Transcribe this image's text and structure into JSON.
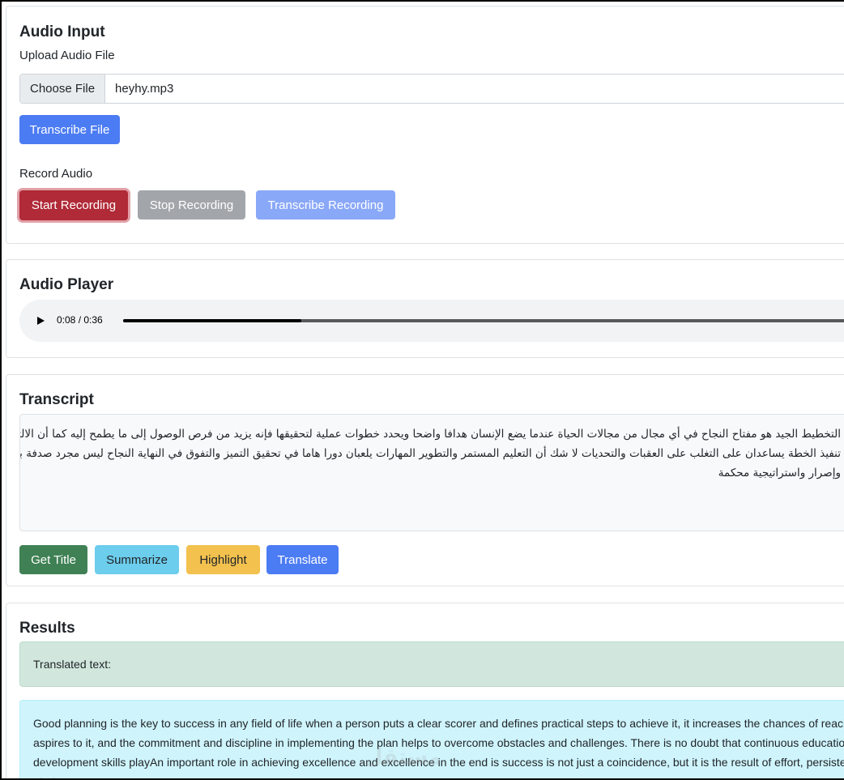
{
  "audio_input": {
    "title": "Audio Input",
    "upload_label": "Upload Audio File",
    "choose_file_label": "Choose File",
    "file_name": "heyhy.mp3",
    "transcribe_file_label": "Transcribe File",
    "record_label": "Record Audio",
    "start_recording_label": "Start Recording",
    "stop_recording_label": "Stop Recording",
    "transcribe_recording_label": "Transcribe Recording"
  },
  "audio_player": {
    "title": "Audio Player",
    "time": "0:08 / 0:36",
    "progress": 0.22
  },
  "transcript": {
    "title": "Transcript",
    "text": "التخطيط الجيد هو مفتاح النجاح في أي مجال من مجالات الحياة عندما يضع الإنسان هدافا واضحا ويحدد خطوات عملية لتحقيقها فإنه يزيد من فرص الوصول إلى ما يطمح إليه كما أن الالتزام والانضباط في تنفيذ الخطة يساعدان على التغلب على العقبات والتحديات لا شك أن التعليم المستمر والتطوير المهارات يلعبان دورا هاما في تحقيق التميز والتفوق في النهاية النجاح ليس مجرد صدفة بل هو نتيجة جهد وإصرار واستراتيجية محكمة",
    "get_title_label": "Get Title",
    "summarize_label": "Summarize",
    "highlight_label": "Highlight",
    "translate_label": "Translate"
  },
  "results": {
    "title": "Results",
    "status": "Translated text:",
    "translation": "Good planning is the key to success in any field of life when a person puts a clear scorer and defines practical steps to achieve it, it increases the chances of reaching what aspires to it, and the commitment and discipline in implementing the plan helps to overcome obstacles and challenges. There is no doubt that continuous education and development skills playAn important role in achieving excellence and excellence in the end is success is not just a coincidence, but it is the result of effort, persistence and a tight strategy."
  },
  "watermark": "مستقل",
  "colors": {
    "primary": "#4c7cf3",
    "danger": "#b02a37",
    "secondary": "#a2a6aa",
    "primary_disabled": "#8aa8f8",
    "success": "#3f8154",
    "info": "#6ccdec",
    "warning": "#f2c14e"
  }
}
